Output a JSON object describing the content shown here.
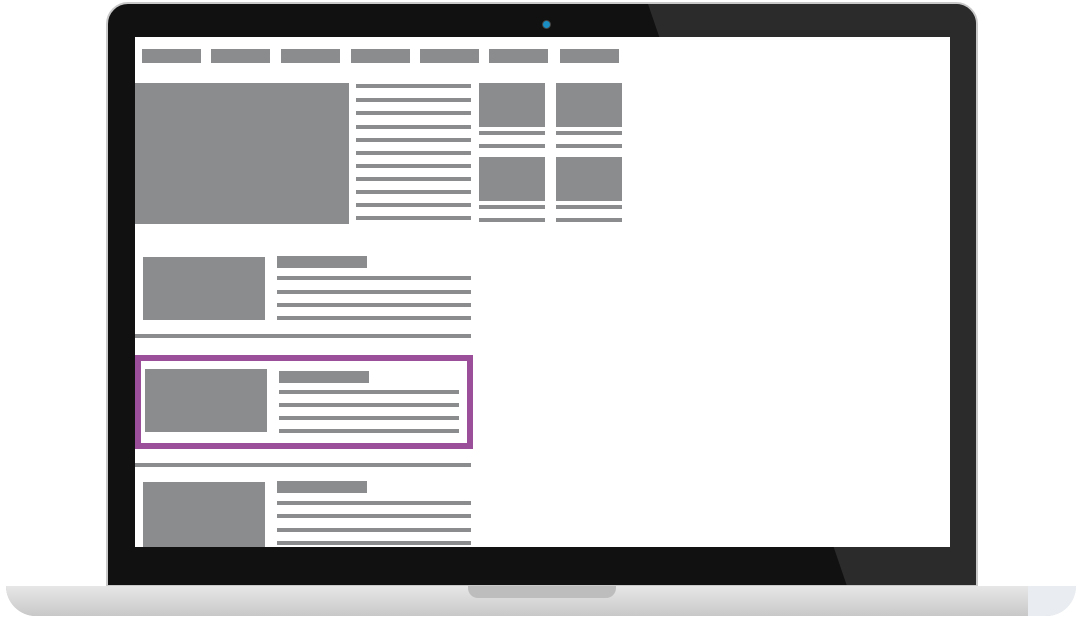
{
  "device": {
    "frame": "laptop",
    "bezel_color": "#111111",
    "camera_color": "#1a8dc2"
  },
  "wireframe": {
    "placeholder_color": "#8b8c8e",
    "highlight_color": "#9b4f9a",
    "nav_item_count": 7,
    "highlighted_item": "list-item-2"
  }
}
